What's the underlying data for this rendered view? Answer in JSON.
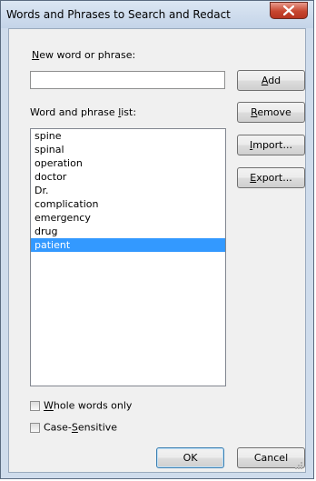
{
  "window": {
    "title": "Words and Phrases to Search and Redact",
    "close_icon": "close-icon"
  },
  "new_phrase": {
    "label_mnemonic": "N",
    "label_rest": "ew word or phrase:",
    "value": "",
    "placeholder": ""
  },
  "buttons": {
    "add": {
      "mnemonic": "A",
      "rest": "dd"
    },
    "remove": {
      "mnemonic": "R",
      "rest": "emove"
    },
    "import": {
      "mnemonic": "I",
      "rest": "mport..."
    },
    "export": {
      "mnemonic": "E",
      "rest": "xport..."
    },
    "ok": "OK",
    "cancel": "Cancel"
  },
  "list": {
    "label_before": "Word and phrase ",
    "label_mnemonic": "l",
    "label_after": "ist:",
    "items": [
      "spine",
      "spinal",
      "operation",
      "doctor",
      "Dr.",
      "complication",
      "emergency",
      "drug",
      "patient"
    ],
    "selected": "patient"
  },
  "options": {
    "whole_words": {
      "mnemonic": "W",
      "rest": "hole words only",
      "checked": false
    },
    "case_sensitive": {
      "before": "Case-",
      "mnemonic": "S",
      "rest": "ensitive",
      "checked": false
    }
  },
  "colors": {
    "selection": "#3399ff",
    "close_button": "#c7472f",
    "frame": "#cfdcec"
  }
}
